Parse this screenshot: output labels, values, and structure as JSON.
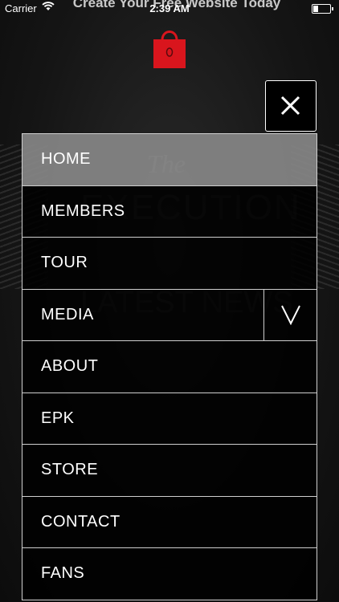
{
  "status_bar": {
    "carrier": "Carrier",
    "time": "2:39 AM",
    "banner_title": "Create Your Free Website Today"
  },
  "background": {
    "script_title": "The",
    "band_name": "EXECUTION",
    "section_heading": "LATEST NEWS"
  },
  "colors": {
    "accent": "#d9151d",
    "menu_bg": "#000000",
    "active_bg": "#878787",
    "border": "#cfcfcf"
  },
  "icons": {
    "store": "shopping-bag-icon",
    "close": "close-icon",
    "expand": "chevron-down-icon"
  },
  "menu": {
    "items": [
      {
        "label": "HOME"
      },
      {
        "label": "MEMBERS"
      },
      {
        "label": "TOUR"
      },
      {
        "label": "MEDIA"
      },
      {
        "label": "ABOUT"
      },
      {
        "label": "EPK"
      },
      {
        "label": "STORE"
      },
      {
        "label": "CONTACT"
      },
      {
        "label": "FANS"
      }
    ]
  }
}
